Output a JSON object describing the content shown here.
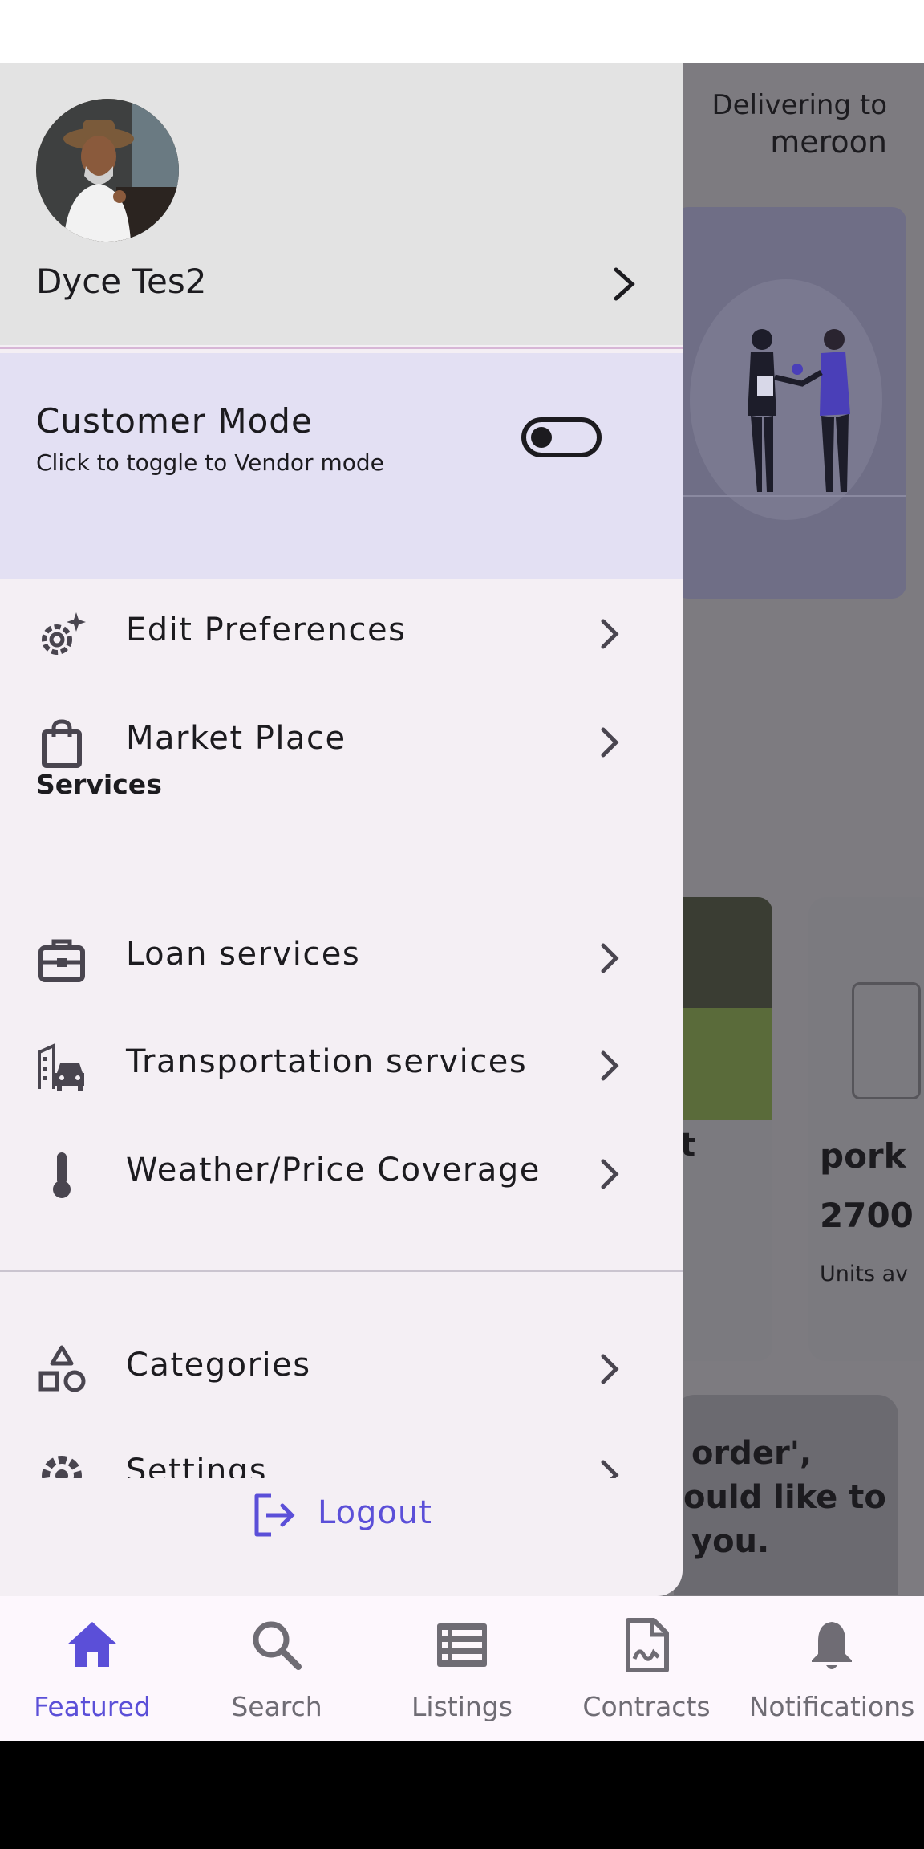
{
  "background": {
    "delivering_label": "Delivering to",
    "delivering_location": "meroon",
    "product_title_partial": "t",
    "product2_title": "pork",
    "product2_price": "2700",
    "product2_units": "Units av",
    "banner_line1": "order',",
    "banner_line2": "ould like to",
    "banner_line3": "you."
  },
  "drawer": {
    "user_name": "Dyce Tes2",
    "mode": {
      "title": "Customer Mode",
      "subtitle": "Click to toggle to Vendor mode",
      "toggle_on": false
    },
    "items": [
      {
        "label": "Edit Preferences",
        "icon": "settings-sparkle-icon"
      },
      {
        "label": "Market Place",
        "icon": "shopping-bag-icon"
      }
    ],
    "services_heading": "Services",
    "services": [
      {
        "label": "Loan services",
        "icon": "briefcase-icon"
      },
      {
        "label": "Transportation services",
        "icon": "building-car-icon"
      },
      {
        "label": "Weather/Price Coverage",
        "icon": "thermometer-icon"
      }
    ],
    "more": [
      {
        "label": "Categories",
        "icon": "shapes-icon"
      },
      {
        "label": "Settings",
        "icon": "gear-icon"
      }
    ],
    "logout_label": "Logout"
  },
  "bottom_nav": {
    "items": [
      {
        "label": "Featured",
        "icon": "home-icon",
        "active": true
      },
      {
        "label": "Search",
        "icon": "search-icon",
        "active": false
      },
      {
        "label": "Listings",
        "icon": "list-icon",
        "active": false
      },
      {
        "label": "Contracts",
        "icon": "contract-icon",
        "active": false
      },
      {
        "label": "Notifications",
        "icon": "bell-icon",
        "active": false
      }
    ]
  },
  "colors": {
    "accent": "#5b4fd8",
    "drawer_bg": "#f4eff4",
    "mode_panel_bg": "#e3e0f3",
    "header_bg": "#e3e3e3",
    "scrim": "#7d7b80"
  }
}
